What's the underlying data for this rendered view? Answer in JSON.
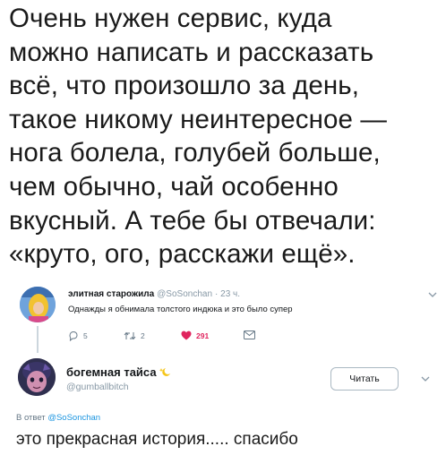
{
  "main_text_lines": [
    "Очень нужен сервис, куда",
    "можно написать и рассказать",
    "всё, что произошло за день,",
    "такое никому неинтересное —",
    "нога болела, голубей больше,",
    "чем обычно, чай особенно",
    "вкусный. А тебе бы отвечали:",
    "«круто, ого, расскажи ещё»."
  ],
  "tweet1": {
    "name": "элитная старожила",
    "handle": "@SoSonchan",
    "time": "· 23 ч.",
    "text": "Однажды я обнимала толстого индюка и это было супер",
    "replies": "5",
    "retweets": "2",
    "likes": "291"
  },
  "tweet2": {
    "name": "богемная тайса",
    "handle": "@gumballbitch",
    "follow_label": "Читать",
    "reply_prefix": "В ответ",
    "reply_handle": "@SoSonchan",
    "text": "это прекрасная история..... спасибо"
  },
  "colors": {
    "accent": "#1b95e0",
    "like": "#e0245e",
    "muted": "#8899a6"
  }
}
